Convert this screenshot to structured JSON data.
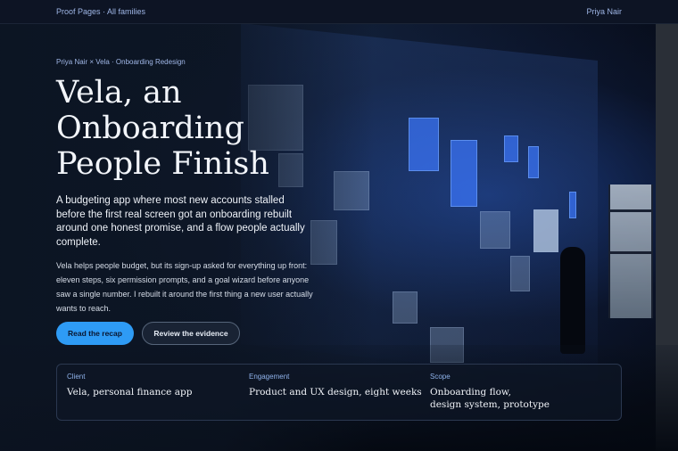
{
  "nav": {
    "breadcrumb": "Proof Pages · All families",
    "user_name": "Priya Nair"
  },
  "hero": {
    "eyebrow": "Priya Nair × Vela · Onboarding Redesign",
    "title": "Vela, an Onboarding People Finish",
    "lede": "A budgeting app where most new accounts stalled before the first real screen got an onboarding rebuilt around one honest promise, and a flow people actually complete.",
    "body": "Vela helps people budget, but its sign-up asked for everything up front: eleven steps, six permission prompts, and a goal wizard before anyone saw a single number. I rebuilt it around the first thing a new user actually wants to reach.",
    "primary_cta": "Read the recap",
    "secondary_cta": "Review the evidence"
  },
  "facts": [
    {
      "label": "Client",
      "value": "Vela, personal finance app"
    },
    {
      "label": "Engagement",
      "value": "Product and UX design, eight weeks"
    },
    {
      "label": "Scope",
      "value": "Onboarding flow,\ndesign system, prototype"
    }
  ],
  "colors": {
    "accent": "#2e9bf5",
    "background": "#0b1220",
    "label": "#8fb2ea"
  }
}
